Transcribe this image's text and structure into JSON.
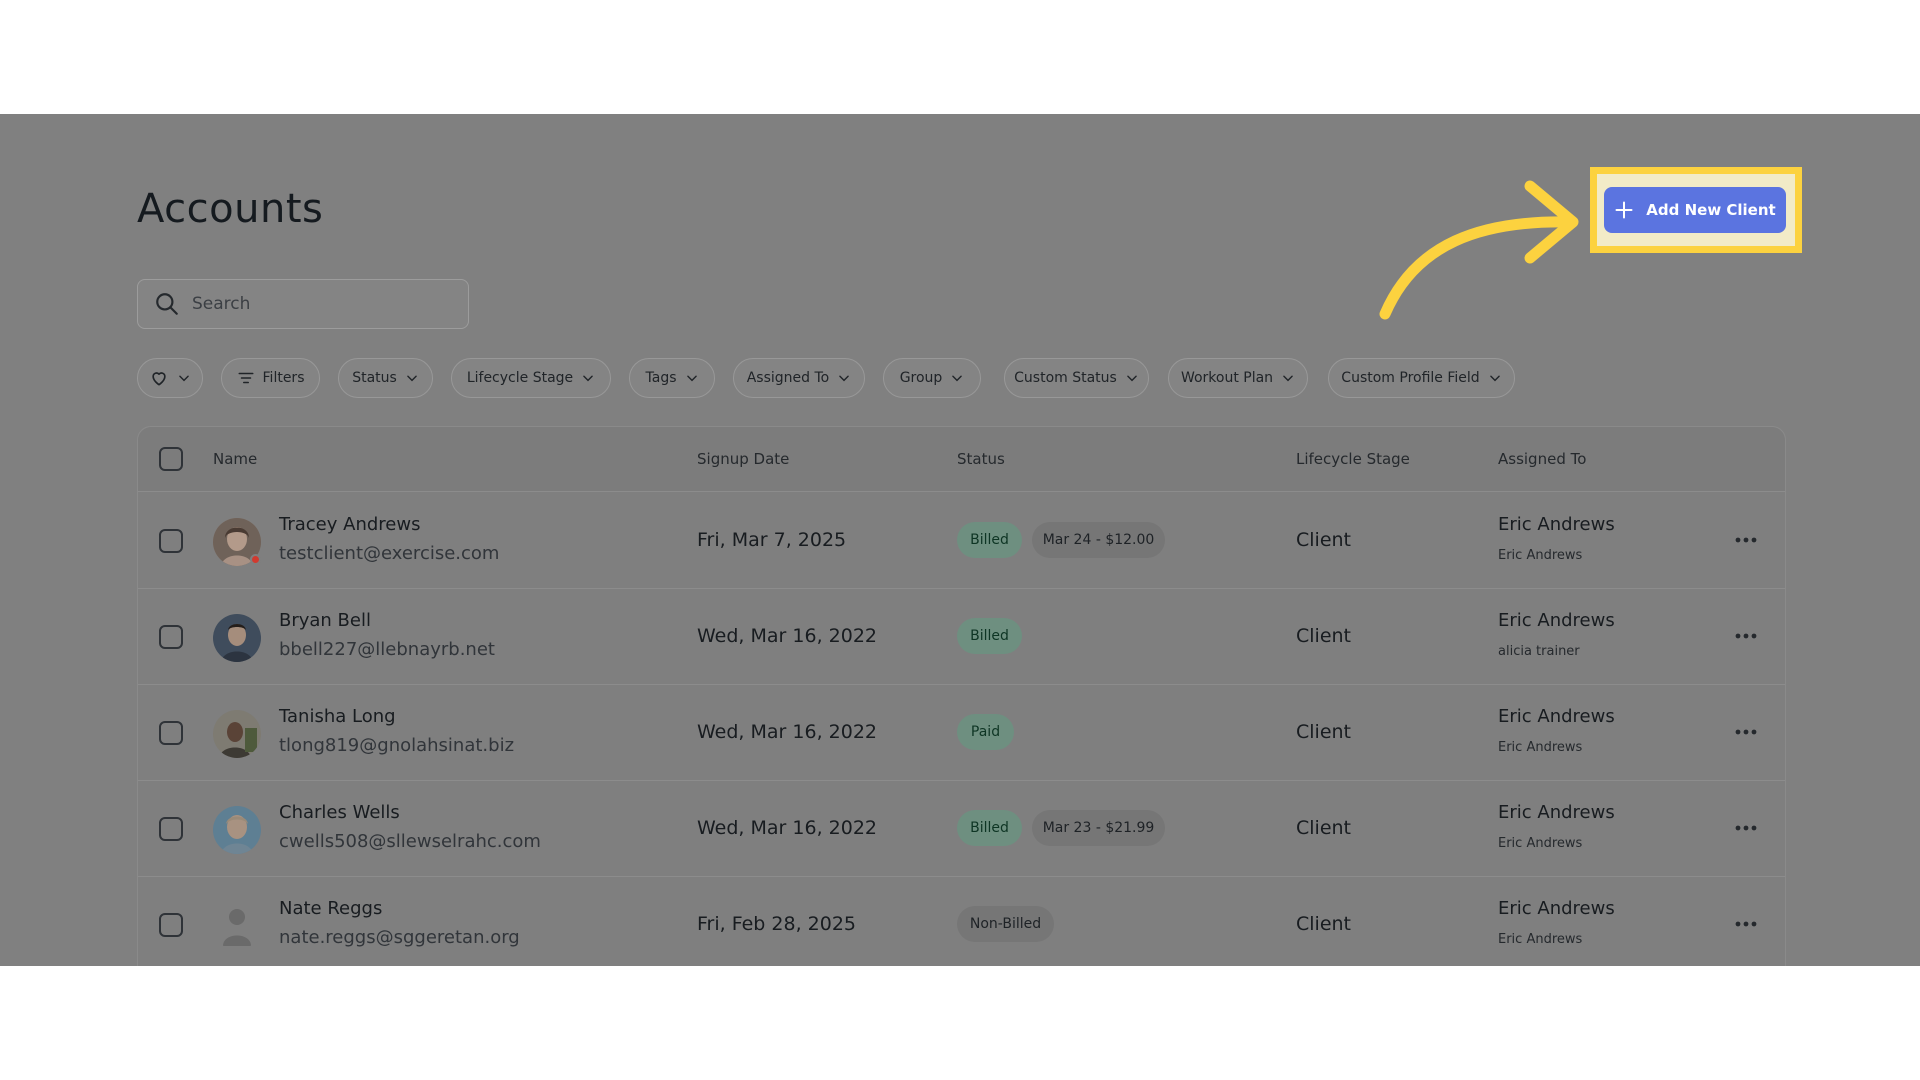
{
  "page": {
    "title": "Accounts"
  },
  "search": {
    "placeholder": "Search"
  },
  "filters": {
    "favorites_icon": "heart-icon",
    "filters_label": "Filters",
    "status": "Status",
    "lifecycle": "Lifecycle Stage",
    "tags": "Tags",
    "assigned": "Assigned To",
    "group": "Group",
    "custom_status": "Custom Status",
    "workout": "Workout Plan",
    "custom_profile": "Custom Profile Field"
  },
  "actions": {
    "add_client": "Add New Client"
  },
  "table": {
    "headers": {
      "name": "Name",
      "signup": "Signup Date",
      "status": "Status",
      "lifecycle": "Lifecycle Stage",
      "assigned": "Assigned To"
    },
    "rows": [
      {
        "name": "Tracey Andrews",
        "email": "testclient@exercise.com",
        "signup": "Fri, Mar 7, 2025",
        "status": "Billed",
        "billing": "Mar 24 - $12.00",
        "stage": "Client",
        "assigned": "Eric Andrews",
        "assigned_sub": "Eric Andrews"
      },
      {
        "name": "Bryan Bell",
        "email": "bbell227@llebnayrb.net",
        "signup": "Wed, Mar 16, 2022",
        "status": "Billed",
        "billing": "",
        "stage": "Client",
        "assigned": "Eric Andrews",
        "assigned_sub": "alicia trainer"
      },
      {
        "name": "Tanisha Long",
        "email": "tlong819@gnolahsinat.biz",
        "signup": "Wed, Mar 16, 2022",
        "status": "Paid",
        "billing": "",
        "stage": "Client",
        "assigned": "Eric Andrews",
        "assigned_sub": "Eric Andrews"
      },
      {
        "name": "Charles Wells",
        "email": "cwells508@sllewselrahc.com",
        "signup": "Wed, Mar 16, 2022",
        "status": "Billed",
        "billing": "Mar 23 - $21.99",
        "stage": "Client",
        "assigned": "Eric Andrews",
        "assigned_sub": "Eric Andrews"
      },
      {
        "name": "Nate Reggs",
        "email": "nate.reggs@sggeretan.org",
        "signup": "Fri, Feb 28, 2025",
        "status": "Non-Billed",
        "billing": "",
        "stage": "Client",
        "assigned": "Eric Andrews",
        "assigned_sub": "Eric Andrews"
      }
    ]
  },
  "colors": {
    "accent": "#5b74e0",
    "highlight": "#fcd23f",
    "overlay": "#808080",
    "badge_green": "#6e8f80"
  }
}
